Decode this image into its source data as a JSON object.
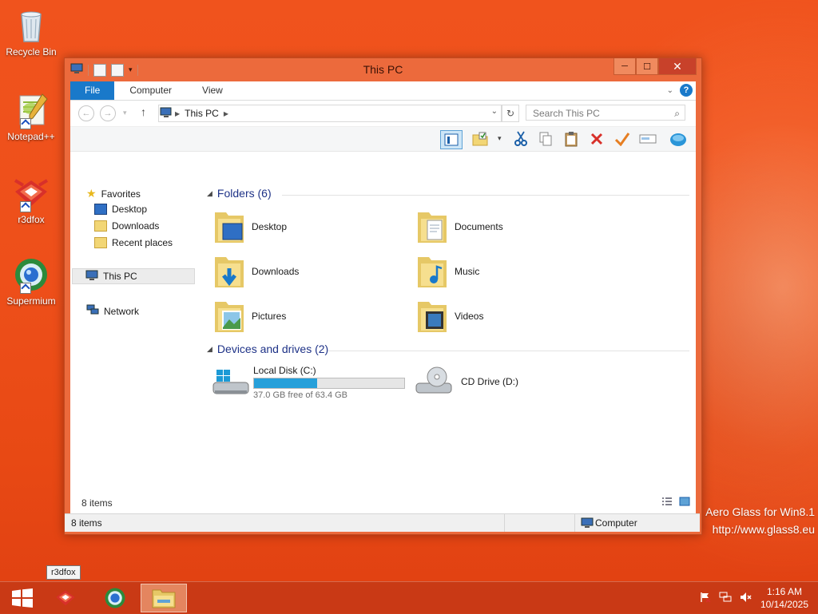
{
  "desktop": {
    "icons": [
      {
        "label": "Recycle Bin"
      },
      {
        "label": "Notepad++"
      },
      {
        "label": "r3dfox"
      },
      {
        "label": "Supermium"
      }
    ],
    "watermark_line1": "Aero Glass for Win8.1",
    "watermark_line2": "http://www.glass8.eu"
  },
  "window": {
    "title": "This PC",
    "caption": {
      "minimize": "─",
      "maximize": "☐",
      "close": "✕"
    },
    "ribbon_tabs": [
      "File",
      "Computer",
      "View"
    ],
    "address": {
      "path_item": "This PC"
    },
    "search": {
      "placeholder": "Search This PC"
    },
    "nav": {
      "favorites": "Favorites",
      "desktop": "Desktop",
      "downloads": "Downloads",
      "recent": "Recent places",
      "this_pc": "This PC",
      "network": "Network"
    },
    "folders_header": "Folders (6)",
    "folders": [
      {
        "label": "Desktop"
      },
      {
        "label": "Documents"
      },
      {
        "label": "Downloads"
      },
      {
        "label": "Music"
      },
      {
        "label": "Pictures"
      },
      {
        "label": "Videos"
      }
    ],
    "devices_header": "Devices and drives (2)",
    "drives": [
      {
        "label": "Local Disk (C:)",
        "free_text": "37.0 GB free of 63.4 GB",
        "used_fraction": 0.42
      },
      {
        "label": "CD Drive (D:)"
      }
    ],
    "inner_status": "8 items",
    "status_left": "8 items",
    "status_right": "Computer"
  },
  "taskbar": {
    "tooltip": "r3dfox",
    "time": "1:16 AM",
    "date": "10/14/2025"
  },
  "colors": {
    "accent": "#1979ca",
    "header_blue": "#1e3287",
    "desktop_orange": "#ee4f1a"
  }
}
